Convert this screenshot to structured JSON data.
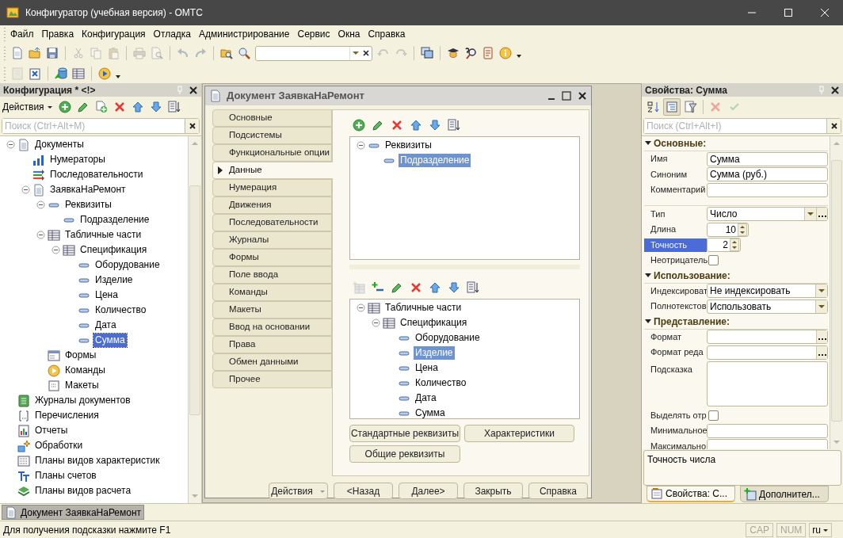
{
  "window": {
    "title": "Конфигуратор (учебная версия) - ОМТС"
  },
  "menu": [
    "Файл",
    "Правка",
    "Конфигурация",
    "Отладка",
    "Администрирование",
    "Сервис",
    "Окна",
    "Справка"
  ],
  "toolbar_1": [
    {
      "kind": "new",
      "disabled": false
    },
    {
      "kind": "open",
      "disabled": false
    },
    {
      "kind": "save",
      "disabled": false
    },
    {
      "kind": "separator"
    },
    {
      "kind": "cut",
      "disabled": true
    },
    {
      "kind": "copy",
      "disabled": true
    },
    {
      "kind": "paste",
      "disabled": true
    },
    {
      "kind": "separator"
    },
    {
      "kind": "print",
      "disabled": true
    },
    {
      "kind": "preview",
      "disabled": true
    },
    {
      "kind": "separator"
    },
    {
      "kind": "undo",
      "disabled": true
    },
    {
      "kind": "redo",
      "disabled": true
    },
    {
      "kind": "separator"
    },
    {
      "kind": "find-folder",
      "disabled": false
    },
    {
      "kind": "search",
      "disabled": false
    },
    {
      "kind": "search-field"
    },
    {
      "kind": "find-previous",
      "disabled": true
    },
    {
      "kind": "find-next",
      "disabled": true
    },
    {
      "kind": "separator"
    },
    {
      "kind": "windows",
      "disabled": false
    },
    {
      "kind": "separator"
    },
    {
      "kind": "graduate",
      "disabled": false
    },
    {
      "kind": "help-search",
      "disabled": false
    },
    {
      "kind": "book",
      "disabled": false
    },
    {
      "kind": "info",
      "disabled": false
    },
    {
      "kind": "menu-caret"
    }
  ],
  "toolbar_2": [
    {
      "kind": "module",
      "disabled": true
    },
    {
      "kind": "close-window",
      "disabled": false
    },
    {
      "kind": "separator"
    },
    {
      "kind": "database",
      "disabled": false
    },
    {
      "kind": "table",
      "disabled": false
    },
    {
      "kind": "separator"
    },
    {
      "kind": "run",
      "disabled": false
    },
    {
      "kind": "menu-caret"
    }
  ],
  "config_panel": {
    "title": "Конфигурация * <!>",
    "actions_label": "Действия",
    "toolbar": [
      {
        "kind": "add",
        "disabled": false
      },
      {
        "kind": "edit",
        "disabled": false
      },
      {
        "kind": "add-copy",
        "disabled": false
      },
      {
        "kind": "delete",
        "disabled": false
      },
      {
        "kind": "up",
        "disabled": false
      },
      {
        "kind": "down",
        "disabled": false
      },
      {
        "kind": "sort",
        "disabled": false
      }
    ],
    "search": {
      "placeholder": "Поиск (Ctrl+Alt+M)"
    },
    "tree": [
      {
        "label": "Документы",
        "kind": "document",
        "expanded": true,
        "selected": false,
        "children": [
          {
            "label": "Нумераторы",
            "kind": "numerator",
            "selected": false
          },
          {
            "label": "Последовательности",
            "kind": "sequence",
            "selected": false
          },
          {
            "label": "ЗаявкаНаРемонт",
            "kind": "document",
            "expanded": true,
            "selected": false,
            "children": [
              {
                "label": "Реквизиты",
                "kind": "attribute",
                "expanded": true,
                "selected": false,
                "children": [
                  {
                    "label": "Подразделение",
                    "kind": "attribute",
                    "selected": false
                  }
                ]
              },
              {
                "label": "Табличные части",
                "kind": "table",
                "expanded": true,
                "selected": false,
                "children": [
                  {
                    "label": "Спецификация",
                    "kind": "table",
                    "expanded": true,
                    "selected": false,
                    "children": [
                      {
                        "label": "Оборудование",
                        "kind": "attribute",
                        "selected": false
                      },
                      {
                        "label": "Изделие",
                        "kind": "attribute",
                        "selected": false
                      },
                      {
                        "label": "Цена",
                        "kind": "attribute",
                        "selected": false
                      },
                      {
                        "label": "Количество",
                        "kind": "attribute",
                        "selected": false
                      },
                      {
                        "label": "Дата",
                        "kind": "attribute",
                        "selected": false
                      },
                      {
                        "label": "Сумма",
                        "kind": "attribute",
                        "selected": true
                      }
                    ]
                  }
                ]
              },
              {
                "label": "Формы",
                "kind": "form",
                "selected": false
              },
              {
                "label": "Команды",
                "kind": "command",
                "selected": false
              },
              {
                "label": "Макеты",
                "kind": "template",
                "selected": false
              }
            ]
          }
        ]
      },
      {
        "label": "Журналы документов",
        "kind": "journal",
        "selected": false
      },
      {
        "label": "Перечисления",
        "kind": "enum",
        "selected": false
      },
      {
        "label": "Отчеты",
        "kind": "report",
        "selected": false
      },
      {
        "label": "Обработки",
        "kind": "processing",
        "selected": false
      },
      {
        "label": "Планы видов характеристик",
        "kind": "characteristics",
        "selected": false
      },
      {
        "label": "Планы счетов",
        "kind": "accounts",
        "selected": false
      },
      {
        "label": "Планы видов расчета",
        "kind": "calculation",
        "selected": false
      }
    ]
  },
  "document_window": {
    "title": "Документ ЗаявкаНаРемонт",
    "tabs": [
      {
        "label": "Основные",
        "selected": false
      },
      {
        "label": "Подсистемы",
        "selected": false
      },
      {
        "label": "Функциональные опции",
        "selected": false
      },
      {
        "label": "Данные",
        "selected": true
      },
      {
        "label": "Нумерация",
        "selected": false
      },
      {
        "label": "Движения",
        "selected": false
      },
      {
        "label": "Последовательности",
        "selected": false
      },
      {
        "label": "Журналы",
        "selected": false
      },
      {
        "label": "Формы",
        "selected": false
      },
      {
        "label": "Поле ввода",
        "selected": false
      },
      {
        "label": "Команды",
        "selected": false
      },
      {
        "label": "Макеты",
        "selected": false
      },
      {
        "label": "Ввод на основании",
        "selected": false
      },
      {
        "label": "Права",
        "selected": false
      },
      {
        "label": "Обмен данными",
        "selected": false
      },
      {
        "label": "Прочее",
        "selected": false
      }
    ],
    "attributes_toolbar": [
      {
        "kind": "add",
        "disabled": false
      },
      {
        "kind": "edit",
        "disabled": false
      },
      {
        "kind": "delete",
        "disabled": false
      },
      {
        "kind": "up",
        "disabled": false
      },
      {
        "kind": "down",
        "disabled": false
      },
      {
        "kind": "sort",
        "disabled": false
      }
    ],
    "attributes_tree": [
      {
        "label": "Реквизиты",
        "kind": "attribute",
        "expanded": true,
        "selected": false,
        "children": [
          {
            "label": "Подразделение",
            "kind": "attribute",
            "selected": true
          }
        ]
      }
    ],
    "tabular_toolbar": [
      {
        "kind": "add-table",
        "disabled": true
      },
      {
        "kind": "add-attribute",
        "disabled": false
      },
      {
        "kind": "edit",
        "disabled": false
      },
      {
        "kind": "delete",
        "disabled": false
      },
      {
        "kind": "up",
        "disabled": false
      },
      {
        "kind": "down",
        "disabled": false
      },
      {
        "kind": "sort",
        "disabled": false
      }
    ],
    "tabular_tree": [
      {
        "label": "Табличные части",
        "kind": "table",
        "expanded": true,
        "selected": false,
        "children": [
          {
            "label": "Спецификация",
            "kind": "table",
            "expanded": true,
            "selected": false,
            "children": [
              {
                "label": "Оборудование",
                "kind": "attribute",
                "selected": false
              },
              {
                "label": "Изделие",
                "kind": "attribute",
                "selected": true
              },
              {
                "label": "Цена",
                "kind": "attribute",
                "selected": false
              },
              {
                "label": "Количество",
                "kind": "attribute",
                "selected": false
              },
              {
                "label": "Дата",
                "kind": "attribute",
                "selected": false
              },
              {
                "label": "Сумма",
                "kind": "attribute",
                "selected": false
              }
            ]
          }
        ]
      }
    ],
    "pane_buttons": [
      "Стандартные реквизиты",
      "Характеристики",
      "Общие реквизиты"
    ],
    "footer_buttons": [
      {
        "label": "Действия",
        "kind": "menu"
      },
      {
        "label": "<Назад",
        "kind": "plain"
      },
      {
        "label": "Далее>",
        "kind": "plain"
      },
      {
        "label": "Закрыть",
        "kind": "plain"
      },
      {
        "label": "Справка",
        "kind": "plain"
      }
    ]
  },
  "properties_panel": {
    "title": "Свойства: Сумма",
    "toolbar": [
      {
        "kind": "sort-az",
        "disabled": false,
        "pressed": false
      },
      {
        "kind": "categories",
        "disabled": false,
        "pressed": true
      },
      {
        "kind": "filter",
        "disabled": false,
        "pressed": false
      },
      {
        "kind": "separator"
      },
      {
        "kind": "delete",
        "disabled": true,
        "pressed": false
      },
      {
        "kind": "check",
        "disabled": true,
        "pressed": false
      }
    ],
    "search": {
      "placeholder": "Поиск (Ctrl+Alt+I)"
    },
    "sections": [
      {
        "title": "Основные:",
        "expanded": true,
        "rows": [
          {
            "kind": "text",
            "label": "Имя",
            "value": "Сумма",
            "selected": false
          },
          {
            "kind": "text",
            "label": "Синоним",
            "value": "Сумма (руб.)",
            "selected": false
          },
          {
            "kind": "text",
            "label": "Комментарий",
            "selected": false
          },
          {
            "kind": "separator"
          },
          {
            "kind": "select-button",
            "label": "Тип",
            "value": "Число",
            "selected": false
          },
          {
            "kind": "spin",
            "label": "Длина",
            "value": "10",
            "selected": false
          },
          {
            "kind": "spin",
            "label": "Точность",
            "value": "2",
            "selected": true
          },
          {
            "kind": "checkbox",
            "label": "Неотрицатель",
            "checked": false,
            "selected": false
          }
        ]
      },
      {
        "title": "Использование:",
        "expanded": true,
        "rows": [
          {
            "kind": "select",
            "label": "Индексироват",
            "value": "Не индексировать",
            "selected": false
          },
          {
            "kind": "select",
            "label": "Полнотекстов",
            "value": "Использовать",
            "selected": false
          }
        ]
      },
      {
        "title": "Представление:",
        "expanded": true,
        "rows": [
          {
            "kind": "text-button",
            "label": "Формат",
            "selected": false
          },
          {
            "kind": "text-button",
            "label": "Формат реда",
            "selected": false
          },
          {
            "kind": "memo",
            "label": "Подсказка",
            "selected": false
          },
          {
            "kind": "checkbox",
            "label": "Выделять отр",
            "checked": false,
            "selected": false
          },
          {
            "kind": "text",
            "label": "Минимальное",
            "selected": false
          },
          {
            "kind": "text",
            "label": "Максимально",
            "selected": false
          }
        ]
      }
    ],
    "description": "Точность числа",
    "tabs": [
      {
        "label": "Свойства: С...",
        "kind": "properties",
        "selected": true
      },
      {
        "label": "Дополнител...",
        "kind": "extra",
        "selected": false
      }
    ]
  },
  "window_bar": [
    {
      "label": "Документ ЗаявкаНаРемонт",
      "selected": true
    }
  ],
  "status_bar": {
    "hint": "Для получения подсказки нажмите F1",
    "indicators": [
      {
        "label": "CAP",
        "active": false
      },
      {
        "label": "NUM",
        "active": false
      }
    ],
    "language": "ru"
  }
}
